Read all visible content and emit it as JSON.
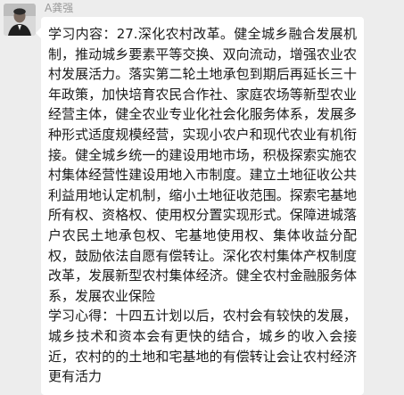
{
  "sender": {
    "name": "A龚强"
  },
  "message": {
    "paragraphs": [
      "学习内容：27.深化农村改革。健全城乡融合发展机制，推动城乡要素平等交换、双向流动，增强农业农村发展活力。落实第二轮土地承包到期后再延长三十年政策，加快培育农民合作社、家庭农场等新型农业经营主体，健全农业专业化社会化服务体系，发展多种形式适度规模经营，实现小农户和现代农业有机衔接。健全城乡统一的建设用地市场，积极探索实施农村集体经营性建设用地入市制度。建立土地征收公共利益用地认定机制，缩小土地征收范围。探索宅基地所有权、资格权、使用权分置实现形式。保障进城落户农民土地承包权、宅基地使用权、集体收益分配权，鼓励依法自愿有偿转让。深化农村集体产权制度改革，发展新型农村集体经济。健全农村金融服务体系，发展农业保险",
      "学习心得：十四五计划以后，农村会有较快的发展，城乡技术和资本会有更快的结合，城乡的收入会接近，农村的的土地和宅基地的有偿转让会让农村经济更有活力"
    ]
  }
}
